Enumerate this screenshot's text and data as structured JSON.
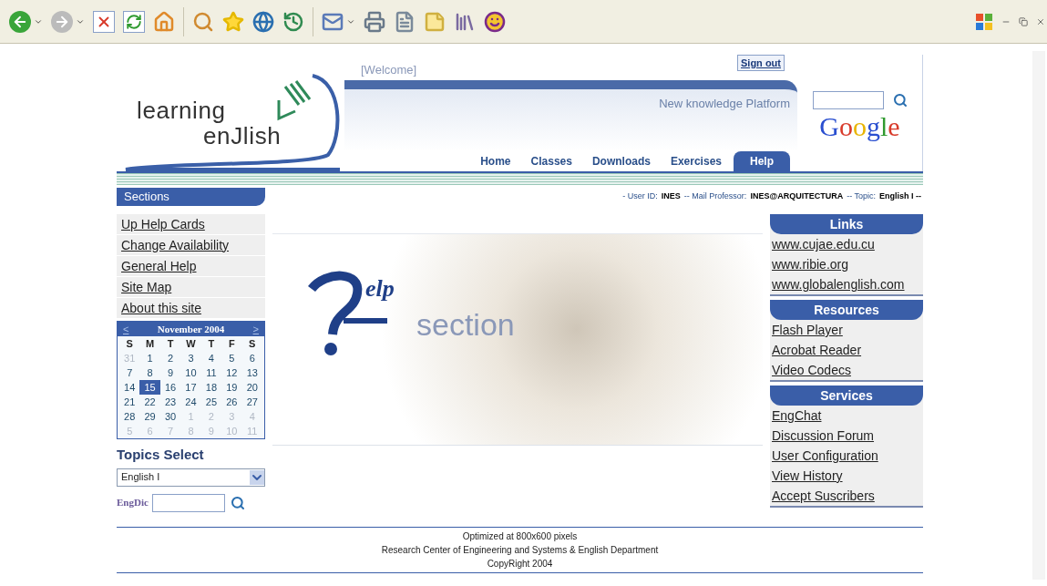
{
  "header": {
    "welcome": "[Welcome]",
    "sign_out": "Sign out",
    "tagline": "New knowledge Platform",
    "logo_top": "learning",
    "logo_bottom": "enJlish",
    "google": "Google"
  },
  "nav": [
    {
      "label": "Home",
      "selected": false
    },
    {
      "label": "Classes",
      "selected": false
    },
    {
      "label": "Downloads",
      "selected": false
    },
    {
      "label": "Exercises",
      "selected": false
    },
    {
      "label": "Help",
      "selected": true
    }
  ],
  "sections_title": "Sections",
  "info_line": [
    {
      "label": "- User ID:",
      "value": "INES"
    },
    {
      "label": "-- Mail Professor:",
      "value": "INES@ARQUITECTURA"
    },
    {
      "label": "-- Topic:",
      "value": "English I --"
    }
  ],
  "sidebar": {
    "items": [
      "Up Help Cards",
      "Change Availability",
      "General Help",
      "Site Map",
      "About this site"
    ]
  },
  "calendar": {
    "prev": "<",
    "title": "November 2004",
    "next": ">",
    "weekdays": [
      "S",
      "M",
      "T",
      "W",
      "T",
      "F",
      "S"
    ],
    "days": [
      {
        "label": "31",
        "muted": true,
        "selected": false
      },
      {
        "label": "1",
        "muted": false,
        "selected": false
      },
      {
        "label": "2",
        "muted": false,
        "selected": false
      },
      {
        "label": "3",
        "muted": false,
        "selected": false
      },
      {
        "label": "4",
        "muted": false,
        "selected": false
      },
      {
        "label": "5",
        "muted": false,
        "selected": false
      },
      {
        "label": "6",
        "muted": false,
        "selected": false
      },
      {
        "label": "7",
        "muted": false,
        "selected": false
      },
      {
        "label": "8",
        "muted": false,
        "selected": false
      },
      {
        "label": "9",
        "muted": false,
        "selected": false
      },
      {
        "label": "10",
        "muted": false,
        "selected": false
      },
      {
        "label": "11",
        "muted": false,
        "selected": false
      },
      {
        "label": "12",
        "muted": false,
        "selected": false
      },
      {
        "label": "13",
        "muted": false,
        "selected": false
      },
      {
        "label": "14",
        "muted": false,
        "selected": false
      },
      {
        "label": "15",
        "muted": false,
        "selected": true
      },
      {
        "label": "16",
        "muted": false,
        "selected": false
      },
      {
        "label": "17",
        "muted": false,
        "selected": false
      },
      {
        "label": "18",
        "muted": false,
        "selected": false
      },
      {
        "label": "19",
        "muted": false,
        "selected": false
      },
      {
        "label": "20",
        "muted": false,
        "selected": false
      },
      {
        "label": "21",
        "muted": false,
        "selected": false
      },
      {
        "label": "22",
        "muted": false,
        "selected": false
      },
      {
        "label": "23",
        "muted": false,
        "selected": false
      },
      {
        "label": "24",
        "muted": false,
        "selected": false
      },
      {
        "label": "25",
        "muted": false,
        "selected": false
      },
      {
        "label": "26",
        "muted": false,
        "selected": false
      },
      {
        "label": "27",
        "muted": false,
        "selected": false
      },
      {
        "label": "28",
        "muted": false,
        "selected": false
      },
      {
        "label": "29",
        "muted": false,
        "selected": false
      },
      {
        "label": "30",
        "muted": false,
        "selected": false
      },
      {
        "label": "1",
        "muted": true,
        "selected": false
      },
      {
        "label": "2",
        "muted": true,
        "selected": false
      },
      {
        "label": "3",
        "muted": true,
        "selected": false
      },
      {
        "label": "4",
        "muted": true,
        "selected": false
      },
      {
        "label": "5",
        "muted": true,
        "selected": false
      },
      {
        "label": "6",
        "muted": true,
        "selected": false
      },
      {
        "label": "7",
        "muted": true,
        "selected": false
      },
      {
        "label": "8",
        "muted": true,
        "selected": false
      },
      {
        "label": "9",
        "muted": true,
        "selected": false
      },
      {
        "label": "10",
        "muted": true,
        "selected": false
      },
      {
        "label": "11",
        "muted": true,
        "selected": false
      }
    ]
  },
  "topics": {
    "title": "Topics Select",
    "value": "English I"
  },
  "dictionary": {
    "label": "EngDic"
  },
  "help_graphic": {
    "script": "elp",
    "word": "section"
  },
  "right_panels": [
    {
      "title": "Links",
      "items": [
        "www.cujae.edu.cu",
        "www.ribie.org",
        "www.globalenglish.com"
      ]
    },
    {
      "title": "Resources",
      "items": [
        "Flash Player",
        "Acrobat Reader",
        "Video Codecs"
      ]
    },
    {
      "title": "Services",
      "items": [
        "EngChat",
        "Discussion Forum",
        "User Configuration",
        "View History",
        "Accept Suscribers"
      ]
    }
  ],
  "footer": [
    "Optimized at 800x600 pixels",
    "Research Center of Engineering and Systems & English Department",
    "CopyRight 2004"
  ]
}
